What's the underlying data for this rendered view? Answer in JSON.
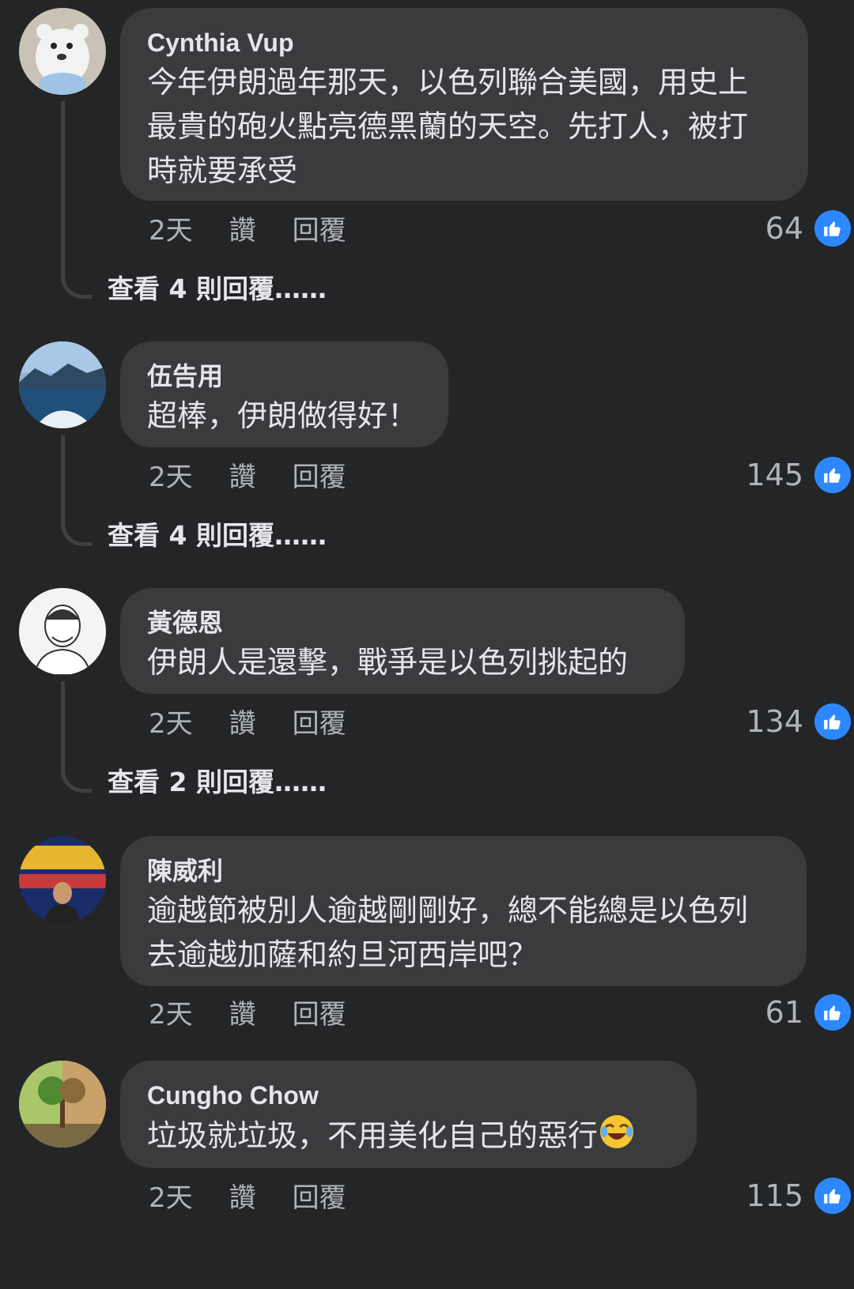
{
  "comments": [
    {
      "author": "Cynthia Vup",
      "text": "今年伊朗過年那天，以色列聯合美國，用史上\n最貴的砲火點亮德黑蘭的天空。先打人，被打\n時就要承受",
      "time": "2天",
      "like_label": "讚",
      "reply_label": "回覆",
      "likes": "64",
      "view_replies": "查看 4 則回覆……"
    },
    {
      "author": "伍告用",
      "text": "超棒，伊朗做得好！",
      "time": "2天",
      "like_label": "讚",
      "reply_label": "回覆",
      "likes": "145",
      "view_replies": "查看 4 則回覆……"
    },
    {
      "author": "黃德恩",
      "text": "伊朗人是還擊，戰爭是以色列挑起的",
      "time": "2天",
      "like_label": "讚",
      "reply_label": "回覆",
      "likes": "134",
      "view_replies": "查看 2 則回覆……"
    },
    {
      "author": "陳威利",
      "text": "逾越節被別人逾越剛剛好，總不能總是以色列\n去逾越加薩和約旦河西岸吧？",
      "time": "2天",
      "like_label": "讚",
      "reply_label": "回覆",
      "likes": "61"
    },
    {
      "author": "Cungho  Chow",
      "text": "垃圾就垃圾，不用美化自己的惡行",
      "emoji": "laughing-crying-emoji",
      "time": "2天",
      "like_label": "讚",
      "reply_label": "回覆",
      "likes": "115"
    }
  ],
  "colors": {
    "background": "#242526",
    "bubble": "#3a3b3c",
    "like_blue": "#2d88ff",
    "secondary_text": "#b0b3b8"
  }
}
